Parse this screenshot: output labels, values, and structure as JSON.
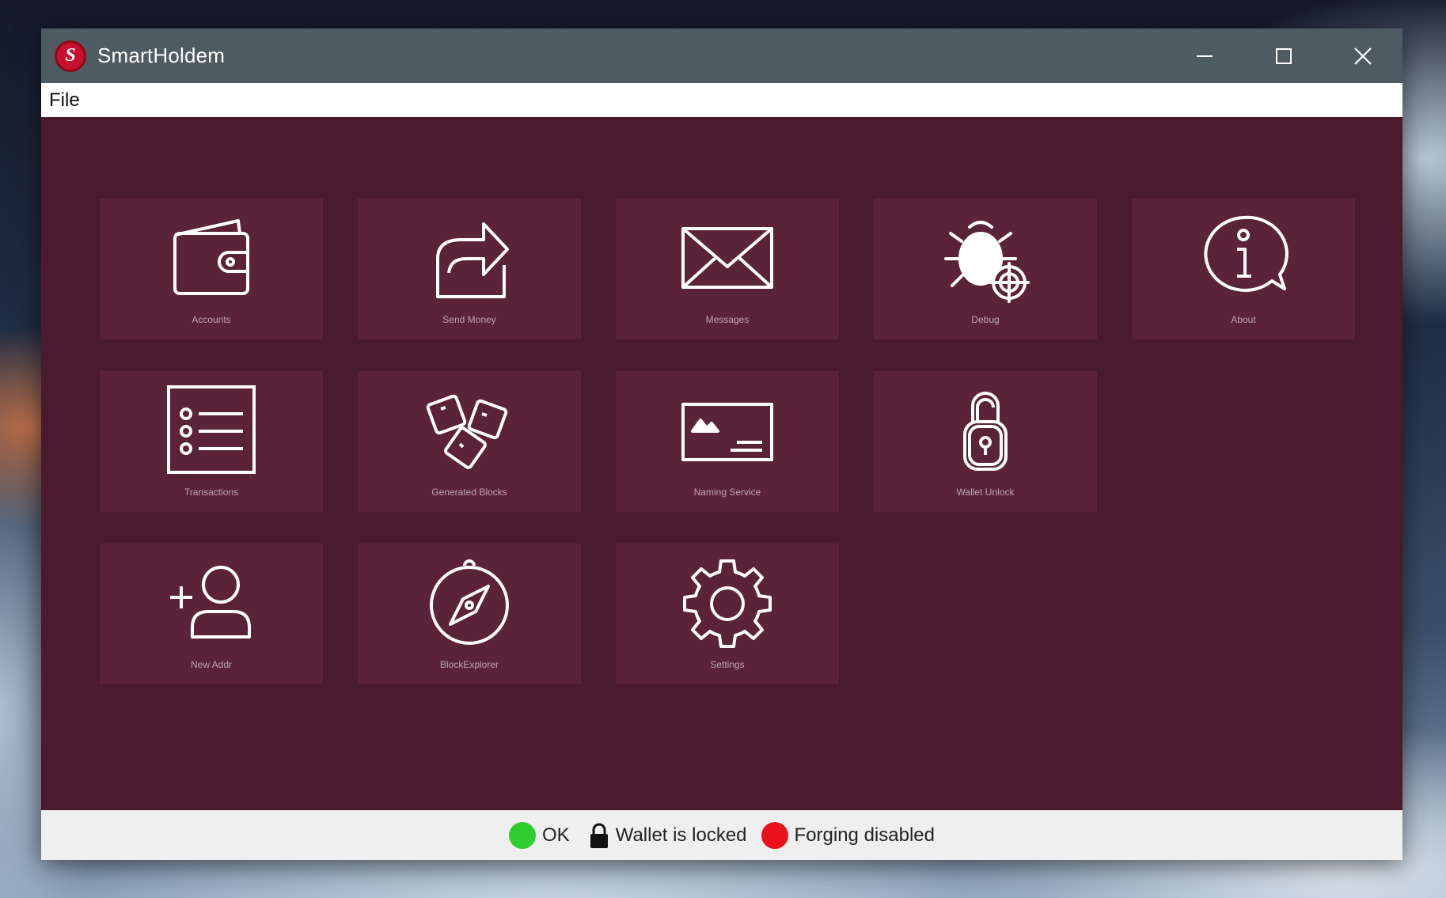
{
  "window": {
    "title": "SmartHoldem",
    "logo_letter": "S",
    "controls": [
      "minimize",
      "maximize",
      "close"
    ]
  },
  "menu": {
    "items": [
      {
        "label": "File"
      }
    ]
  },
  "tiles": [
    {
      "label": "Accounts",
      "icon": "wallet-icon"
    },
    {
      "label": "Send Money",
      "icon": "share-arrow-icon"
    },
    {
      "label": "Messages",
      "icon": "envelope-icon"
    },
    {
      "label": "Debug",
      "icon": "bug-icon"
    },
    {
      "label": "About",
      "icon": "info-bubble-icon"
    },
    {
      "label": "Transactions",
      "icon": "list-icon"
    },
    {
      "label": "Generated Blocks",
      "icon": "blocks-icon"
    },
    {
      "label": "Naming Service",
      "icon": "card-icon"
    },
    {
      "label": "Wallet Unlock",
      "icon": "padlock-open-icon"
    },
    {
      "label": "New Addr",
      "icon": "add-user-icon"
    },
    {
      "label": "BlockExplorer",
      "icon": "compass-icon"
    },
    {
      "label": "Settings",
      "icon": "gear-icon"
    }
  ],
  "status": {
    "connection": {
      "label": "OK",
      "color": "#2ecc2e"
    },
    "wallet": {
      "label": "Wallet is locked"
    },
    "forging": {
      "label": "Forging disabled",
      "color": "#e8121c"
    }
  },
  "colors": {
    "content_bg": "#4a1a2e",
    "tile_bg": "#5a2338",
    "titlebar_bg": "#4f5b62",
    "statusbar_bg": "#efefef"
  }
}
